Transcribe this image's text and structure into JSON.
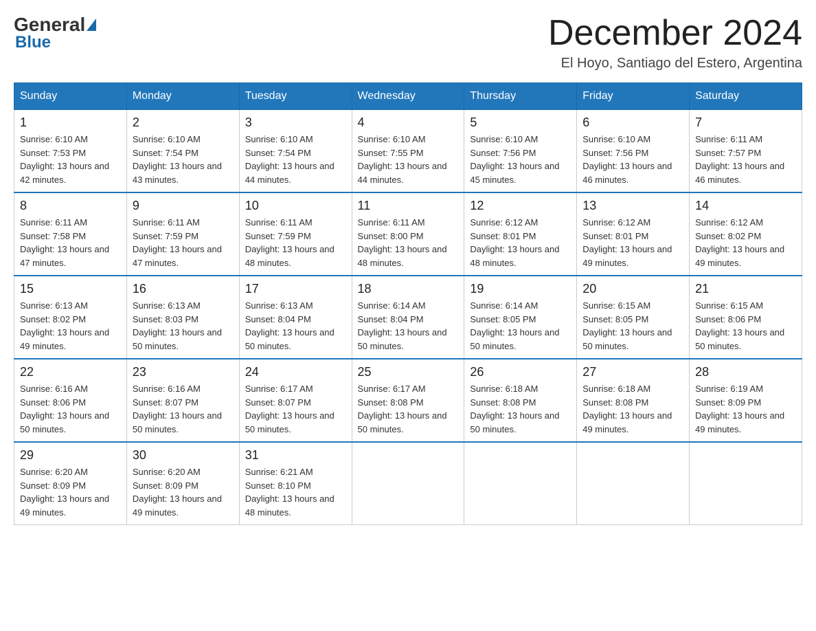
{
  "header": {
    "logo_general": "General",
    "logo_blue": "Blue",
    "month_title": "December 2024",
    "location": "El Hoyo, Santiago del Estero, Argentina"
  },
  "days_of_week": [
    "Sunday",
    "Monday",
    "Tuesday",
    "Wednesday",
    "Thursday",
    "Friday",
    "Saturday"
  ],
  "weeks": [
    [
      {
        "day": "1",
        "sunrise": "6:10 AM",
        "sunset": "7:53 PM",
        "daylight": "13 hours and 42 minutes."
      },
      {
        "day": "2",
        "sunrise": "6:10 AM",
        "sunset": "7:54 PM",
        "daylight": "13 hours and 43 minutes."
      },
      {
        "day": "3",
        "sunrise": "6:10 AM",
        "sunset": "7:54 PM",
        "daylight": "13 hours and 44 minutes."
      },
      {
        "day": "4",
        "sunrise": "6:10 AM",
        "sunset": "7:55 PM",
        "daylight": "13 hours and 44 minutes."
      },
      {
        "day": "5",
        "sunrise": "6:10 AM",
        "sunset": "7:56 PM",
        "daylight": "13 hours and 45 minutes."
      },
      {
        "day": "6",
        "sunrise": "6:10 AM",
        "sunset": "7:56 PM",
        "daylight": "13 hours and 46 minutes."
      },
      {
        "day": "7",
        "sunrise": "6:11 AM",
        "sunset": "7:57 PM",
        "daylight": "13 hours and 46 minutes."
      }
    ],
    [
      {
        "day": "8",
        "sunrise": "6:11 AM",
        "sunset": "7:58 PM",
        "daylight": "13 hours and 47 minutes."
      },
      {
        "day": "9",
        "sunrise": "6:11 AM",
        "sunset": "7:59 PM",
        "daylight": "13 hours and 47 minutes."
      },
      {
        "day": "10",
        "sunrise": "6:11 AM",
        "sunset": "7:59 PM",
        "daylight": "13 hours and 48 minutes."
      },
      {
        "day": "11",
        "sunrise": "6:11 AM",
        "sunset": "8:00 PM",
        "daylight": "13 hours and 48 minutes."
      },
      {
        "day": "12",
        "sunrise": "6:12 AM",
        "sunset": "8:01 PM",
        "daylight": "13 hours and 48 minutes."
      },
      {
        "day": "13",
        "sunrise": "6:12 AM",
        "sunset": "8:01 PM",
        "daylight": "13 hours and 49 minutes."
      },
      {
        "day": "14",
        "sunrise": "6:12 AM",
        "sunset": "8:02 PM",
        "daylight": "13 hours and 49 minutes."
      }
    ],
    [
      {
        "day": "15",
        "sunrise": "6:13 AM",
        "sunset": "8:02 PM",
        "daylight": "13 hours and 49 minutes."
      },
      {
        "day": "16",
        "sunrise": "6:13 AM",
        "sunset": "8:03 PM",
        "daylight": "13 hours and 50 minutes."
      },
      {
        "day": "17",
        "sunrise": "6:13 AM",
        "sunset": "8:04 PM",
        "daylight": "13 hours and 50 minutes."
      },
      {
        "day": "18",
        "sunrise": "6:14 AM",
        "sunset": "8:04 PM",
        "daylight": "13 hours and 50 minutes."
      },
      {
        "day": "19",
        "sunrise": "6:14 AM",
        "sunset": "8:05 PM",
        "daylight": "13 hours and 50 minutes."
      },
      {
        "day": "20",
        "sunrise": "6:15 AM",
        "sunset": "8:05 PM",
        "daylight": "13 hours and 50 minutes."
      },
      {
        "day": "21",
        "sunrise": "6:15 AM",
        "sunset": "8:06 PM",
        "daylight": "13 hours and 50 minutes."
      }
    ],
    [
      {
        "day": "22",
        "sunrise": "6:16 AM",
        "sunset": "8:06 PM",
        "daylight": "13 hours and 50 minutes."
      },
      {
        "day": "23",
        "sunrise": "6:16 AM",
        "sunset": "8:07 PM",
        "daylight": "13 hours and 50 minutes."
      },
      {
        "day": "24",
        "sunrise": "6:17 AM",
        "sunset": "8:07 PM",
        "daylight": "13 hours and 50 minutes."
      },
      {
        "day": "25",
        "sunrise": "6:17 AM",
        "sunset": "8:08 PM",
        "daylight": "13 hours and 50 minutes."
      },
      {
        "day": "26",
        "sunrise": "6:18 AM",
        "sunset": "8:08 PM",
        "daylight": "13 hours and 50 minutes."
      },
      {
        "day": "27",
        "sunrise": "6:18 AM",
        "sunset": "8:08 PM",
        "daylight": "13 hours and 49 minutes."
      },
      {
        "day": "28",
        "sunrise": "6:19 AM",
        "sunset": "8:09 PM",
        "daylight": "13 hours and 49 minutes."
      }
    ],
    [
      {
        "day": "29",
        "sunrise": "6:20 AM",
        "sunset": "8:09 PM",
        "daylight": "13 hours and 49 minutes."
      },
      {
        "day": "30",
        "sunrise": "6:20 AM",
        "sunset": "8:09 PM",
        "daylight": "13 hours and 49 minutes."
      },
      {
        "day": "31",
        "sunrise": "6:21 AM",
        "sunset": "8:10 PM",
        "daylight": "13 hours and 48 minutes."
      },
      null,
      null,
      null,
      null
    ]
  ]
}
